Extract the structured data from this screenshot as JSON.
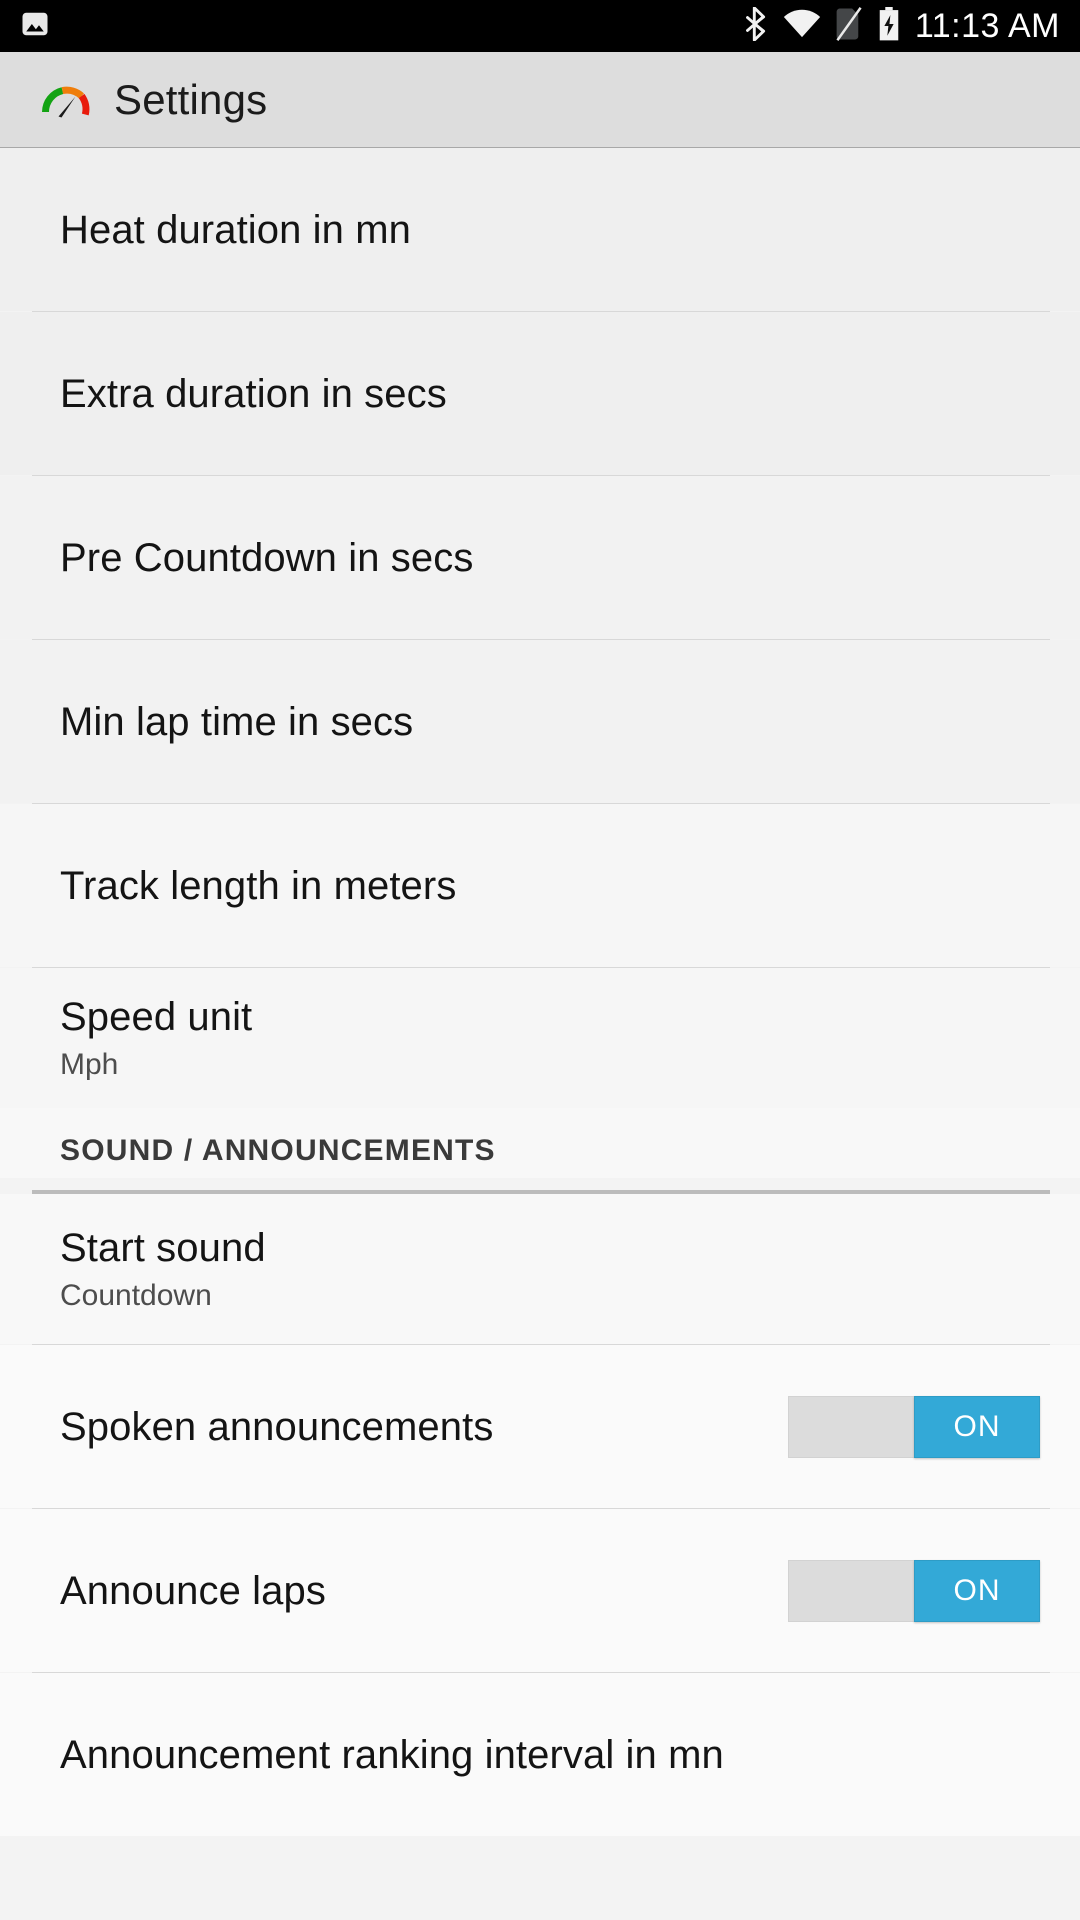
{
  "statusbar": {
    "notification_icon": "image-icon",
    "icons": [
      "bluetooth-icon",
      "wifi-icon",
      "no-sim-icon",
      "battery-charging-icon"
    ],
    "clock": "11:13 AM"
  },
  "actionbar": {
    "logo": "speedometer-icon",
    "title": "Settings",
    "background": "#dddddd"
  },
  "theme": {
    "accent": "#33a9d7",
    "switch_track": "#dcdcdc",
    "list_background": "#f3f3f3",
    "divider": "#d8d8d8",
    "title_color": "#141414",
    "summary_color": "#4d4d4d"
  },
  "prefs": [
    {
      "title": "Heat duration in mn",
      "summary": "",
      "type": "input"
    },
    {
      "title": "Extra duration in secs",
      "summary": "",
      "type": "input"
    },
    {
      "title": "Pre Countdown in secs",
      "summary": "",
      "type": "input"
    },
    {
      "title": "Min lap time in secs",
      "summary": "",
      "type": "input"
    },
    {
      "title": "Track length in meters",
      "summary": "",
      "type": "input"
    },
    {
      "title": "Speed unit",
      "summary": "Mph",
      "type": "list"
    }
  ],
  "section": {
    "label": "SOUND / ANNOUNCEMENTS"
  },
  "sound_prefs": [
    {
      "title": "Start sound",
      "summary": "Countdown",
      "type": "list",
      "switch": ""
    },
    {
      "title": "Spoken announcements",
      "summary": "",
      "type": "switch",
      "switch": "ON"
    },
    {
      "title": "Announce laps",
      "summary": "",
      "type": "switch",
      "switch": "ON"
    },
    {
      "title": "Announcement ranking interval in mn",
      "summary": "",
      "type": "input",
      "switch": ""
    }
  ]
}
